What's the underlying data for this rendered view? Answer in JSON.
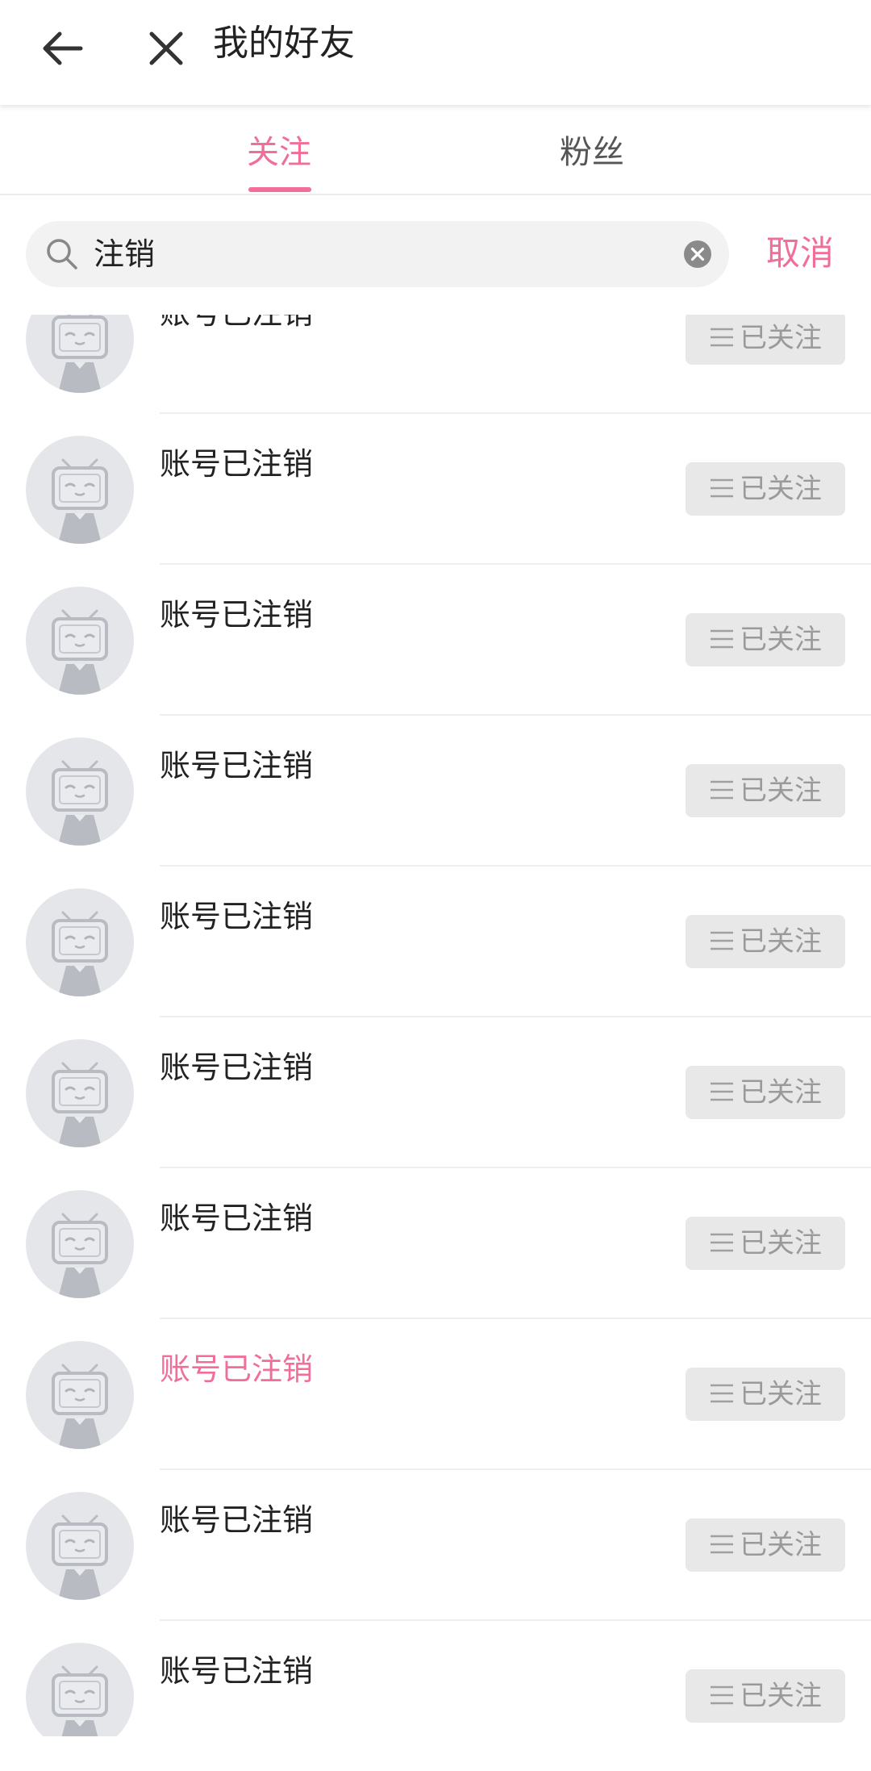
{
  "header": {
    "title": "我的好友",
    "back_icon": "arrow-left-icon",
    "close_icon": "close-icon"
  },
  "tabs": [
    {
      "label": "关注",
      "active": true
    },
    {
      "label": "粉丝",
      "active": false
    }
  ],
  "search": {
    "value": "注销",
    "cancel_label": "取消"
  },
  "colors": {
    "accent": "#f06e97",
    "text": "#222222",
    "button_bg": "#e8e8e8",
    "button_text": "#9a9a9a"
  },
  "list": {
    "items": [
      {
        "name": "账号已注销",
        "button_label": "已关注"
      },
      {
        "name": "账号已注销",
        "button_label": "已关注"
      },
      {
        "name": "账号已注销",
        "button_label": "已关注"
      },
      {
        "name": "账号已注销",
        "button_label": "已关注"
      },
      {
        "name": "账号已注销",
        "button_label": "已关注"
      },
      {
        "name": "账号已注销",
        "button_label": "已关注"
      },
      {
        "name": "账号已注销",
        "button_label": "已关注"
      },
      {
        "name": "账号已注销",
        "button_label": "已关注",
        "highlighted": true
      },
      {
        "name": "账号已注销",
        "button_label": "已关注"
      },
      {
        "name": "账号已注销",
        "button_label": "已关注"
      }
    ]
  }
}
